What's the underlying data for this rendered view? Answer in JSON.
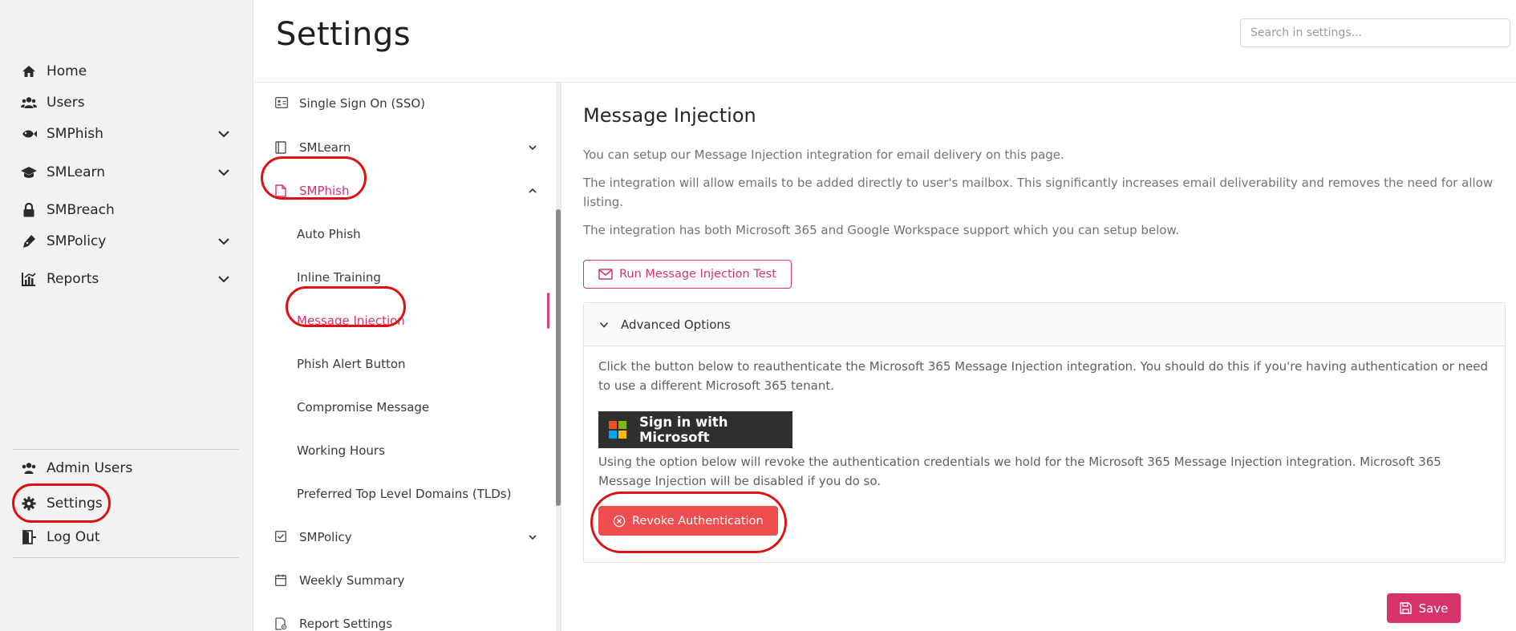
{
  "sidebar": {
    "items": [
      {
        "label": "Home",
        "icon": "home-icon"
      },
      {
        "label": "Users",
        "icon": "users-icon"
      },
      {
        "label": "SMPhish",
        "icon": "fish-icon"
      },
      {
        "label": "SMLearn",
        "icon": "graduation-cap-icon"
      },
      {
        "label": "SMBreach",
        "icon": "lock-icon"
      },
      {
        "label": "SMPolicy",
        "icon": "pen-icon"
      },
      {
        "label": "Reports",
        "icon": "chart-icon"
      }
    ],
    "bottom_items": [
      {
        "label": "Admin Users",
        "icon": "users-icon"
      },
      {
        "label": "Settings",
        "icon": "gear-icon"
      },
      {
        "label": "Log Out",
        "icon": "logout-icon"
      }
    ]
  },
  "header": {
    "title": "Settings",
    "search_placeholder": "Search in settings..."
  },
  "settings_nav": {
    "items": [
      {
        "label": "Single Sign On (SSO)"
      },
      {
        "label": "SMLearn"
      },
      {
        "label": "SMPhish"
      },
      {
        "label": "Auto Phish"
      },
      {
        "label": "Inline Training"
      },
      {
        "label": "Message Injection"
      },
      {
        "label": "Phish Alert Button"
      },
      {
        "label": "Compromise Message"
      },
      {
        "label": "Working Hours"
      },
      {
        "label": "Preferred Top Level Domains (TLDs)"
      },
      {
        "label": "SMPolicy"
      },
      {
        "label": "Weekly Summary"
      },
      {
        "label": "Report Settings"
      }
    ]
  },
  "main": {
    "title": "Message Injection",
    "paragraphs": [
      "You can setup our Message Injection integration for email delivery on this page.",
      "The integration will allow emails to be added directly to user's mailbox. This significantly increases email deliverability and removes the need for allow listing.",
      "The integration has both Microsoft 365 and Google Workspace support which you can setup below."
    ],
    "test_button": "Run Message Injection Test",
    "advanced": {
      "title": "Advanced Options",
      "reauth_text": "Click the button below to reauthenticate the Microsoft 365 Message Injection integration. You should do this if you're having authentication or need to use a different Microsoft 365 tenant.",
      "ms_button": "Sign in with Microsoft",
      "revoke_text": "Using the option below will revoke the authentication credentials we hold for the Microsoft 365 Message Injection integration. Microsoft 365 Message Injection will be disabled if you do so.",
      "revoke_button": "Revoke Authentication"
    },
    "save_button": "Save"
  },
  "colors": {
    "accent": "#d6336c",
    "danger": "#f04e4e",
    "annotation": "#e01010",
    "ms_logo": [
      "#f25022",
      "#7fba00",
      "#00a4ef",
      "#ffb900"
    ]
  }
}
